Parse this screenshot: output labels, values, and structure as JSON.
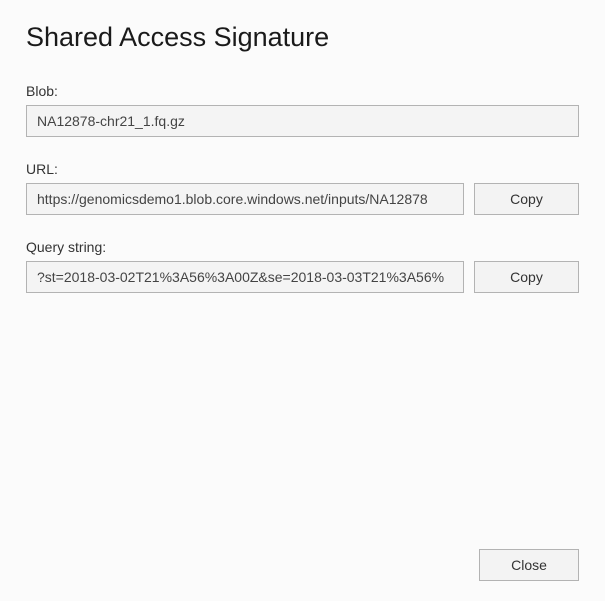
{
  "dialog": {
    "title": "Shared Access Signature"
  },
  "fields": {
    "blob": {
      "label": "Blob:",
      "value": "NA12878-chr21_1.fq.gz"
    },
    "url": {
      "label": "URL:",
      "value": "https://genomicsdemo1.blob.core.windows.net/inputs/NA12878",
      "copy_label": "Copy"
    },
    "query": {
      "label": "Query string:",
      "value": "?st=2018-03-02T21%3A56%3A00Z&se=2018-03-03T21%3A56%",
      "copy_label": "Copy"
    }
  },
  "footer": {
    "close_label": "Close"
  }
}
